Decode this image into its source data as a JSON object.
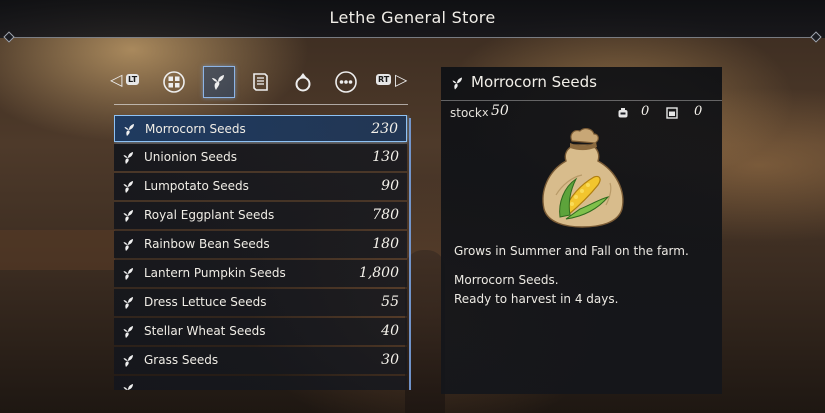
{
  "header": {
    "title": "Lethe General Store"
  },
  "tabs": {
    "left_shoulder": "LT",
    "right_shoulder": "RT",
    "items": [
      {
        "icon": "grid-icon",
        "active": false
      },
      {
        "icon": "seed-sprout-icon",
        "active": true
      },
      {
        "icon": "recipe-scroll-icon",
        "active": false
      },
      {
        "icon": "ring-icon",
        "active": false
      },
      {
        "icon": "more-options-icon",
        "active": false
      }
    ]
  },
  "list": {
    "items": [
      {
        "name": "Morrocorn Seeds",
        "price": "230",
        "selected": true
      },
      {
        "name": "Unionion Seeds",
        "price": "130"
      },
      {
        "name": "Lumpotato Seeds",
        "price": "90"
      },
      {
        "name": "Royal Eggplant Seeds",
        "price": "780"
      },
      {
        "name": "Rainbow Bean Seeds",
        "price": "180"
      },
      {
        "name": "Lantern Pumpkin Seeds",
        "price": "1,800"
      },
      {
        "name": "Dress Lettuce Seeds",
        "price": "55"
      },
      {
        "name": "Stellar Wheat Seeds",
        "price": "40"
      },
      {
        "name": "Grass Seeds",
        "price": "30"
      },
      {
        "name": "",
        "price": ""
      }
    ]
  },
  "detail": {
    "title": "Morrocorn Seeds",
    "stock_label": "stock",
    "stock_x": "x",
    "stock_value": "50",
    "stat_a_value": "0",
    "stat_b_value": "0",
    "description_1": "Grows in Summer and Fall on the farm.",
    "description_2": "Morrocorn Seeds.",
    "description_3": "Ready to harvest in 4 days."
  },
  "colors": {
    "accent": "#8ec2f5",
    "panel": "#14161c"
  }
}
